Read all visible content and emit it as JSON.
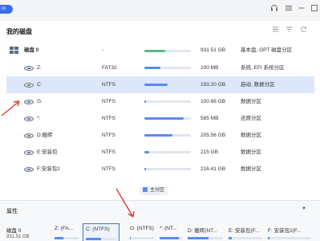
{
  "titlebar": {
    "badge": "ro",
    "icons": [
      "headset-icon",
      "menu-icon",
      "minimize-icon",
      "maximize-icon"
    ]
  },
  "section": {
    "title": "我的磁盘",
    "view_icons": [
      "list-view-icon",
      "filter-icon",
      "refresh-icon"
    ]
  },
  "disk": {
    "name": "磁盘 0",
    "fs": "-",
    "size": "931.51 GB",
    "info": "基本盘, GPT 磁盘分区",
    "usage": 0.45
  },
  "partitions": [
    {
      "name": "Z:",
      "fs": "FAT32",
      "size": "100 MB",
      "info": "系统, EFI 系统分区",
      "usage": 0.35,
      "selected": false
    },
    {
      "name": "C:",
      "fs": "NTFS",
      "size": "193.20 GB",
      "info": "启动, 数据分区",
      "usage": 0.5,
      "selected": true
    },
    {
      "name": "G:",
      "fs": "NTFS",
      "size": "100.66 GB",
      "info": "数据分区",
      "usage": 0.02,
      "selected": false
    },
    {
      "name": "*:",
      "fs": "NTFS",
      "size": "585 MB",
      "info": "还原分区",
      "usage": 0.85,
      "selected": false
    },
    {
      "name": "D:搬砖",
      "fs": "NTFS",
      "size": "205.56 GB",
      "info": "数据分区",
      "usage": 0.6,
      "selected": false
    },
    {
      "name": "E:安装包",
      "fs": "NTFS",
      "size": "215 GB",
      "info": "数据分区",
      "usage": 0.1,
      "selected": false
    },
    {
      "name": "F:安装包2",
      "fs": "NTFS",
      "size": "216.41 GB",
      "info": "数据分区",
      "usage": 0.03,
      "selected": false
    }
  ],
  "legend": {
    "label": "主分区",
    "color": "#5b8bf0"
  },
  "properties": {
    "title": "属性",
    "collapse_icon": "triangle-down-icon"
  },
  "disk_map": {
    "disk_name": "磁盘 0",
    "disk_size": "931.51 GB",
    "parts": [
      {
        "label": "Z: (FA...",
        "usage": 0.35,
        "selected": false
      },
      {
        "label": "C: (NTFS)",
        "usage": 0.5,
        "selected": true
      },
      {
        "label": "G: (NTFS)",
        "usage": 0.02,
        "selected": false
      },
      {
        "label": "*: (NT...",
        "usage": 0.85,
        "selected": false
      },
      {
        "label": "D: 搬砖(NT...",
        "usage": 0.6,
        "selected": false
      },
      {
        "label": "E: 安装包(F...",
        "usage": 0.1,
        "selected": false
      },
      {
        "label": "F: 安装包2(F...",
        "usage": 0.03,
        "selected": false
      }
    ]
  },
  "colors": {
    "accent": "#3c6cf0",
    "bar_fill": "#5b8bf0",
    "bar_fill_alt": "#59b88a",
    "annotation_arrow": "#e23b2e"
  }
}
